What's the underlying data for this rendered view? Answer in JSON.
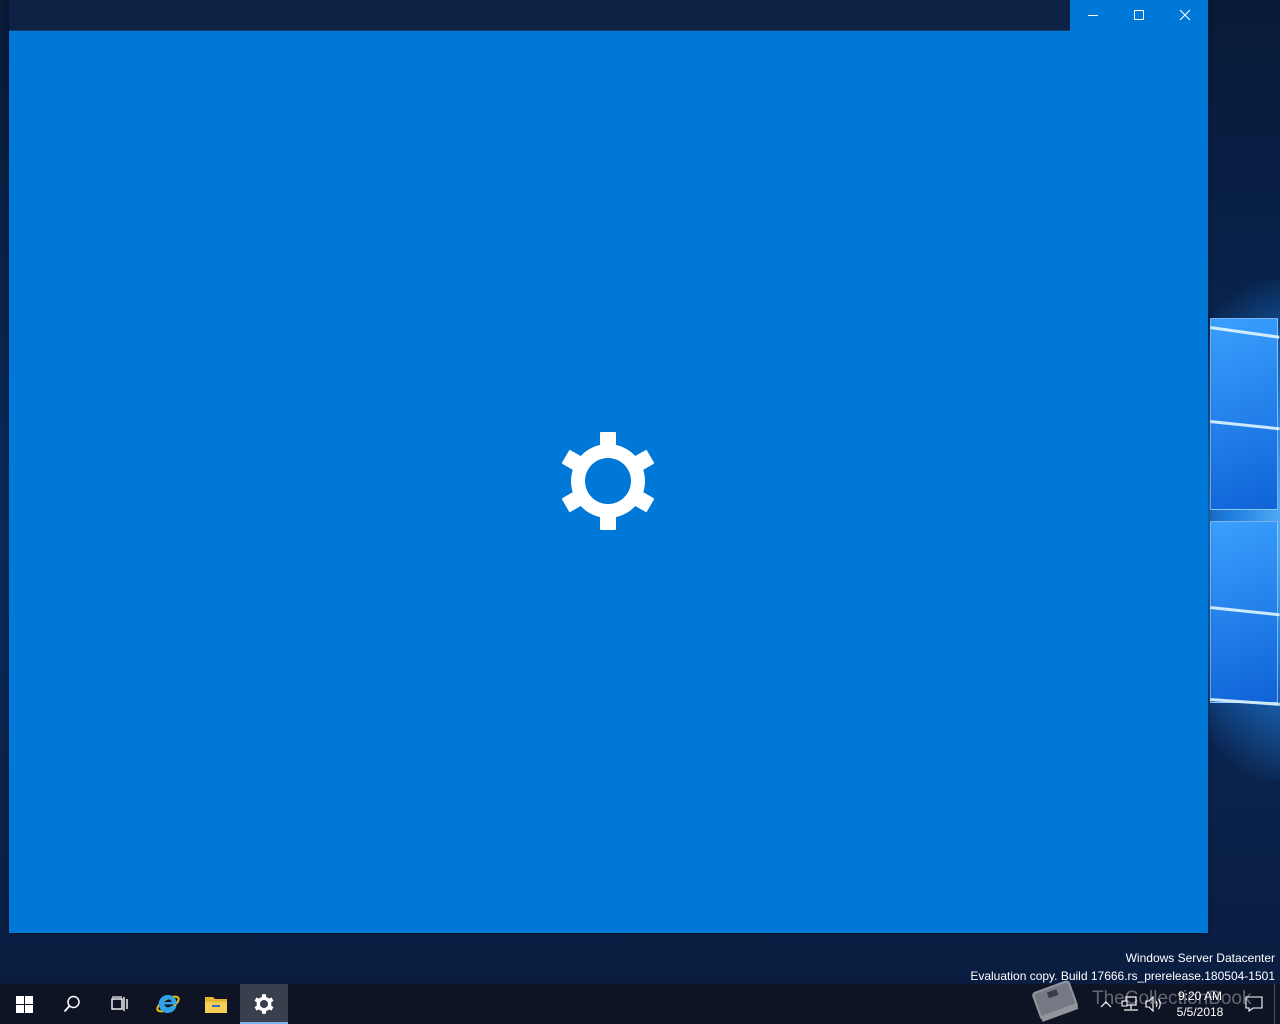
{
  "desktop": {
    "recycle_bin_icon": "recycle-bin-icon"
  },
  "window": {
    "background": "#0078d7",
    "controls": {
      "minimize_icon": "minimize-icon",
      "maximize_icon": "maximize-icon",
      "close_icon": "close-icon"
    },
    "splash_icon": "gear-icon"
  },
  "watermark": {
    "edition": "Windows Server Datacenter",
    "build": "Evaluation copy. Build 17666.rs_prerelease.180504-1501"
  },
  "overlay": {
    "text": "TheCollectionBook"
  },
  "taskbar": {
    "items": [
      {
        "name": "start",
        "icon": "windows-logo-icon"
      },
      {
        "name": "search",
        "icon": "search-icon"
      },
      {
        "name": "task-view",
        "icon": "task-view-icon"
      },
      {
        "name": "internet-explorer",
        "icon": "internet-explorer-icon"
      },
      {
        "name": "file-explorer",
        "icon": "folder-icon"
      },
      {
        "name": "settings",
        "icon": "gear-icon",
        "active": true
      }
    ],
    "tray": {
      "chevron_icon": "chevron-up-icon",
      "network_icon": "network-icon",
      "volume_icon": "volume-icon",
      "time": "9:20 AM",
      "date": "5/5/2018",
      "notification_icon": "action-center-icon"
    }
  }
}
